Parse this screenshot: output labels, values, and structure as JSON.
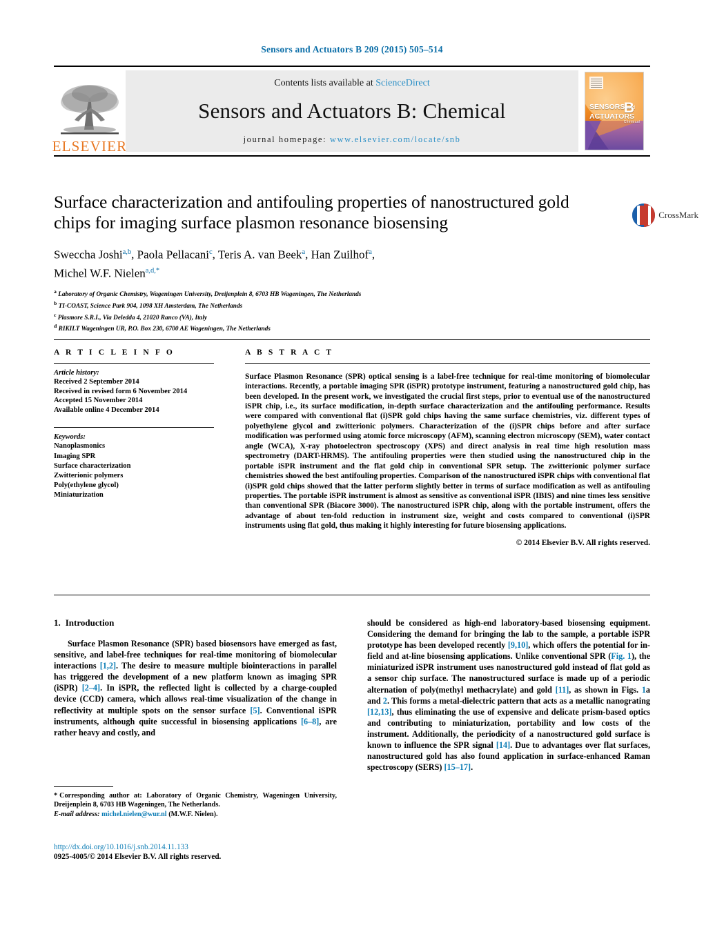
{
  "running_head": "Sensors and Actuators B 209 (2015) 505–514",
  "masthead": {
    "contents_prefix": "Contents lists available at ",
    "sciencedirect": "ScienceDirect",
    "journal_name": "Sensors and Actuators B: Chemical",
    "homepage_label": "journal homepage: ",
    "homepage_url": "www.elsevier.com/locate/snb",
    "publisher": "ELSEVIER",
    "cover": {
      "line1": "SENSORS",
      "and": "and",
      "line2": "ACTUATORS",
      "letter": "B",
      "letter_sub": "Chemical"
    }
  },
  "crossmark": {
    "label": "CrossMark"
  },
  "article": {
    "title": "Surface characterization and antifouling properties of nanostructured gold chips for imaging surface plasmon resonance biosensing",
    "authors_line1_pre": "Sweccha Joshi",
    "authors": "Sweccha Joshi a,b, Paola Pellacani c, Teris A. van Beek a, Han Zuilhof a, Michel W.F. Nielen a,d,*",
    "affiliations": [
      {
        "mark": "a",
        "text": "Laboratory of Organic Chemistry, Wageningen University, Dreijenplein 8, 6703 HB Wageningen, The Netherlands"
      },
      {
        "mark": "b",
        "text": "TI-COAST, Science Park 904, 1098 XH Amsterdam, The Netherlands"
      },
      {
        "mark": "c",
        "text": "Plasmore S.R.I., Via Deledda 4, 21020 Ranco (VA), Italy"
      },
      {
        "mark": "d",
        "text": "RIKILT Wageningen UR, P.O. Box 230, 6700 AE Wageningen, The Netherlands"
      }
    ]
  },
  "article_info": {
    "heading": "A R T I C L E    I N F O",
    "history_label": "Article history:",
    "history": [
      "Received 2 September 2014",
      "Received in revised form 6 November 2014",
      "Accepted 15 November 2014",
      "Available online 4 December 2014"
    ],
    "keywords_label": "Keywords:",
    "keywords": [
      "Nanoplasmonics",
      "Imaging SPR",
      "Surface characterization",
      "Zwitterionic polymers",
      "Poly(ethylene glycol)",
      "Miniaturization"
    ]
  },
  "abstract": {
    "heading": "A B S T R A C T",
    "text": "Surface Plasmon Resonance (SPR) optical sensing is a label-free technique for real-time monitoring of biomolecular interactions. Recently, a portable imaging SPR (iSPR) prototype instrument, featuring a nanostructured gold chip, has been developed. In the present work, we investigated the crucial first steps, prior to eventual use of the nanostructured iSPR chip, i.e., its surface modification, in-depth surface characterization and the antifouling performance. Results were compared with conventional flat (i)SPR gold chips having the same surface chemistries, viz. different types of polyethylene glycol and zwitterionic polymers. Characterization of the (i)SPR chips before and after surface modification was performed using atomic force microscopy (AFM), scanning electron microscopy (SEM), water contact angle (WCA), X-ray photoelectron spectroscopy (XPS) and direct analysis in real time high resolution mass spectrometry (DART-HRMS). The antifouling properties were then studied using the nanostructured chip in the portable iSPR instrument and the flat gold chip in conventional SPR setup. The zwitterionic polymer surface chemistries showed the best antifouling properties. Comparison of the nanostructured iSPR chips with conventional flat (i)SPR gold chips showed that the latter perform slightly better in terms of surface modification as well as antifouling properties. The portable iSPR instrument is almost as sensitive as conventional iSPR (IBIS) and nine times less sensitive than conventional SPR (Biacore 3000). The nanostructured iSPR chip, along with the portable instrument, offers the advantage of about ten-fold reduction in instrument size, weight and costs compared to conventional (i)SPR instruments using flat gold, thus making it highly interesting for future biosensing applications.",
    "copyright": "© 2014 Elsevier B.V. All rights reserved."
  },
  "introduction": {
    "number": "1.",
    "heading": "Introduction",
    "left_paragraph_parts": [
      "Surface Plasmon Resonance (SPR) based biosensors have emerged as fast, sensitive, and label-free techniques for real-time monitoring of biomolecular interactions ",
      "[1,2]",
      ". The desire to measure multiple biointeractions in parallel has triggered the development of a new platform known as imaging SPR (iSPR) ",
      "[2–4]",
      ". In iSPR, the reflected light is collected by a charge-coupled device (CCD) camera, which allows real-time visualization of the change in reflectivity at multiple spots on the sensor surface ",
      "[5]",
      ". Conventional iSPR instruments, although quite successful in biosensing applications ",
      "[6–8]",
      ", are rather heavy and costly, and"
    ],
    "right_paragraph_parts": [
      "should be considered as high-end laboratory-based biosensing equipment. Considering the demand for bringing the lab to the sample, a portable iSPR prototype has been developed recently ",
      "[9,10]",
      ", which offers the potential for in-field and at-line biosensing applications. Unlike conventional SPR (",
      "Fig. 1",
      "), the miniaturized iSPR instrument uses nanostructured gold instead of flat gold as a sensor chip surface. The nanostructured surface is made up of a periodic alternation of poly(methyl methacrylate) and gold ",
      "[11]",
      ", as shown in Figs. ",
      "1",
      "a and ",
      "2",
      ". This forms a metal-dielectric pattern that acts as a metallic nanograting ",
      "[12,13]",
      ", thus eliminating the use of expensive and delicate prism-based optics and contributing to miniaturization, portability and low costs of the instrument. Additionally, the periodicity of a nanostructured gold surface is known to influence the SPR signal ",
      "[14]",
      ". Due to advantages over flat surfaces, nanostructured gold has also found application in surface-enhanced Raman spectroscopy (SERS) ",
      "[15–17]",
      "."
    ]
  },
  "footnote": {
    "star": "*",
    "corresponding": "Corresponding author at: Laboratory of Organic Chemistry, Wageningen University, Dreijenplein 8, 6703 HB Wageningen, The Netherlands.",
    "email_label": "E-mail address:",
    "email": "michel.nielen@wur.nl",
    "email_suffix": "(M.W.F. Nielen)."
  },
  "footer": {
    "doi": "http://dx.doi.org/10.1016/j.snb.2014.11.133",
    "issn_line": "0925-4005/© 2014 Elsevier B.V. All rights reserved."
  },
  "colors": {
    "link": "#0b7cb5",
    "elsevier_orange": "#E87722",
    "header_blue": "#0b6ea8"
  }
}
